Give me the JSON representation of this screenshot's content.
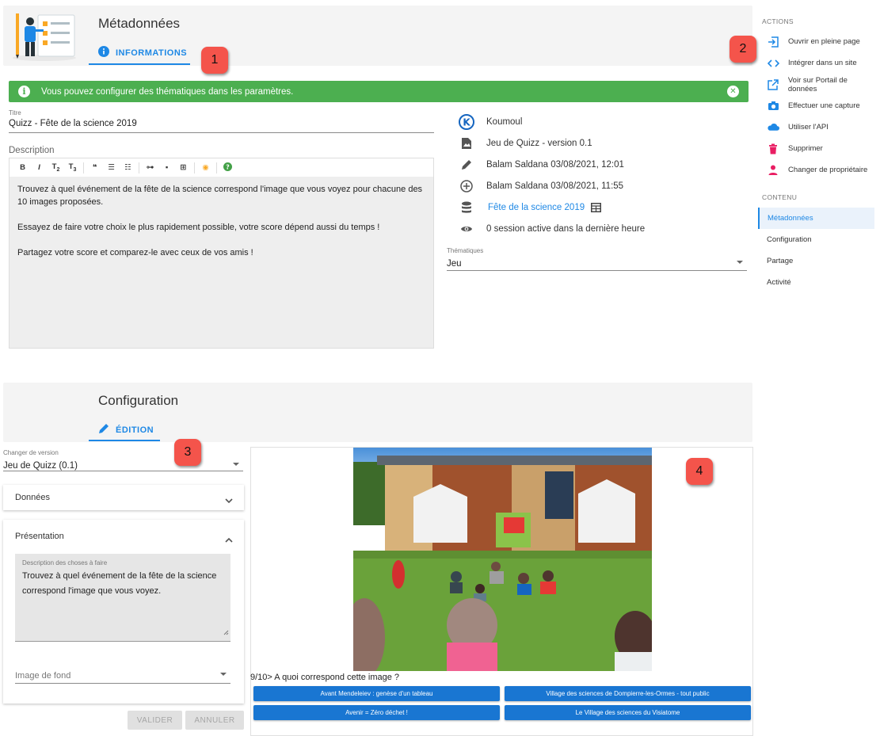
{
  "metadata": {
    "title": "Métadonnées",
    "tab_label": "INFORMATIONS",
    "alert_text": "Vous pouvez configurer des thématiques dans les paramètres.",
    "title_field": {
      "label": "Titre",
      "value": "Quizz - Fête de la science 2019"
    },
    "description_label": "Description",
    "description_paragraphs": [
      "Trouvez à quel événement de la fête de la science correspond l'image que vous voyez pour chacune des 10 images proposées.",
      "Essayez de faire votre choix le plus rapidement possible, votre score dépend aussi du temps !",
      "Partagez votre score et comparez-le avec ceux de vos amis !"
    ],
    "info": {
      "owner": "Koumoul",
      "app": "Jeu de Quizz - version 0.1",
      "updated": "Balam Saldana 03/08/2021, 12:01",
      "created": "Balam Saldana 03/08/2021, 11:55",
      "dataset": "Fête de la science 2019",
      "sessions": "0 session active dans la dernière heure"
    },
    "topics_field": {
      "label": "Thématiques",
      "value": "Jeu"
    }
  },
  "badges": {
    "b1": "1",
    "b2": "2",
    "b3": "3",
    "b4": "4"
  },
  "actions": {
    "heading": "ACTIONS",
    "items": [
      {
        "label": "Ouvrir en pleine page",
        "icon": "open-full-page-icon"
      },
      {
        "label": "Intégrer dans un site",
        "icon": "code-icon"
      },
      {
        "label": "Voir sur Portail de données",
        "icon": "external-link-icon"
      },
      {
        "label": "Effectuer une capture",
        "icon": "camera-icon"
      },
      {
        "label": "Utiliser l'API",
        "icon": "cloud-icon"
      },
      {
        "label": "Supprimer",
        "icon": "trash-icon"
      },
      {
        "label": "Changer de propriétaire",
        "icon": "person-icon"
      }
    ]
  },
  "content_nav": {
    "heading": "CONTENU",
    "items": [
      {
        "label": "Métadonnées",
        "active": true
      },
      {
        "label": "Configuration",
        "active": false
      },
      {
        "label": "Partage",
        "active": false
      },
      {
        "label": "Activité",
        "active": false
      }
    ]
  },
  "configuration": {
    "title": "Configuration",
    "tab_label": "ÉDITION",
    "version_field": {
      "label": "Changer de version",
      "value": "Jeu de Quizz (0.1)"
    },
    "panel_data": "Données",
    "panel_presentation": "Présentation",
    "todo_field": {
      "label": "Description des choses à faire",
      "value": "Trouvez à quel événement de la fête de la science correspond l'image que vous voyez."
    },
    "background_field": {
      "placeholder": "Image de fond"
    },
    "validate_label": "VALIDER",
    "cancel_label": "ANNULER"
  },
  "quiz": {
    "question": "9/10> A quoi correspond cette image ?",
    "answers": [
      "Avant Mendeleiev : genèse d'un tableau",
      "Village des sciences de Dompierre-les-Ormes - tout public",
      "Avenir = Zéro déchet !",
      "Le Village des sciences du Visiatome"
    ]
  },
  "colors": {
    "accent": "#1e88e5",
    "alert_green": "#4caf50",
    "danger": "#e91e63",
    "badge_red": "#f4544b",
    "quiz_button": "#1976d2"
  }
}
